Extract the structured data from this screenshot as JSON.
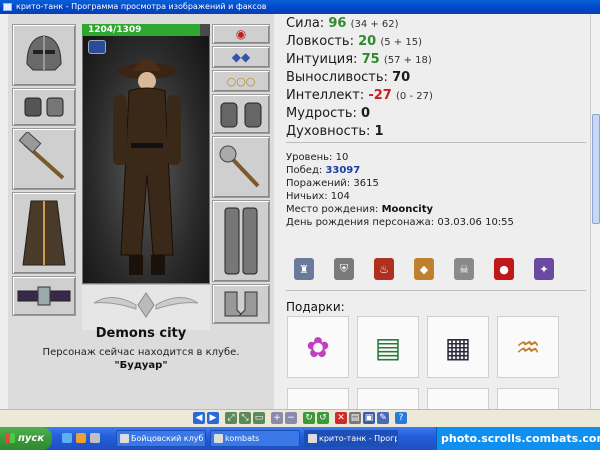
{
  "window": {
    "title": "крито-танк - Программа просмотра изображений и факсов"
  },
  "character": {
    "hp_text": "1204/1309",
    "hp_fraction": 0.92,
    "city": "Demons city",
    "club_status": "Персонаж сейчас находится в клубе.",
    "club_name": "\"Будуар\""
  },
  "stats": [
    {
      "label": "Сила:",
      "value": "96",
      "extra": "(34 + 62)",
      "color": "green"
    },
    {
      "label": "Ловкость:",
      "value": "20",
      "extra": "(5 + 15)",
      "color": "green"
    },
    {
      "label": "Интуиция:",
      "value": "75",
      "extra": "(57 + 18)",
      "color": "green"
    },
    {
      "label": "Выносливость:",
      "value": "70",
      "extra": "",
      "color": "black"
    },
    {
      "label": "Интеллект:",
      "value": "-27",
      "extra": "(0 - 27)",
      "color": "red"
    },
    {
      "label": "Мудрость:",
      "value": "0",
      "extra": "",
      "color": "black"
    },
    {
      "label": "Духовность:",
      "value": "1",
      "extra": "",
      "color": "black"
    }
  ],
  "info": {
    "level_label": "Уровень:",
    "level": "10",
    "wins_label": "Побед:",
    "wins": "33097",
    "losses_label": "Поражений:",
    "losses": "3615",
    "draws_label": "Ничьих:",
    "draws": "104",
    "birthplace_label": "Место рождения:",
    "birthplace": "Mooncity",
    "birthday_label": "День рождения персонажа:",
    "birthday": "03.03.06 10:55"
  },
  "gifts_title": "Подарки:",
  "gifts": [
    {
      "icon": "flower-icon",
      "glyph": "✿"
    },
    {
      "icon": "green-book-icon",
      "glyph": "▤"
    },
    {
      "icon": "dark-book-icon",
      "glyph": "▦"
    },
    {
      "icon": "horn-icon",
      "glyph": "♒"
    },
    {
      "icon": "pear-icon",
      "glyph": "◐"
    },
    {
      "icon": "scroll-icon",
      "glyph": "✉"
    },
    {
      "icon": "chocolate-icon",
      "glyph": "▥"
    },
    {
      "icon": "chocolate-icon",
      "glyph": "▥"
    }
  ],
  "taskbar": {
    "start_label": "пуск",
    "items": [
      {
        "label": "Бойцовский клуб -...",
        "active": false
      },
      {
        "label": "kombats",
        "active": false
      },
      {
        "label": "крито-танк - Програ...",
        "active": true
      }
    ],
    "watermark": "photo.scrolls.combats.com"
  },
  "colors": {
    "titlebar": "#0046c8",
    "stat_green": "#2f8a2f",
    "stat_red": "#cc2020",
    "wins_blue": "#1b3fa0"
  }
}
